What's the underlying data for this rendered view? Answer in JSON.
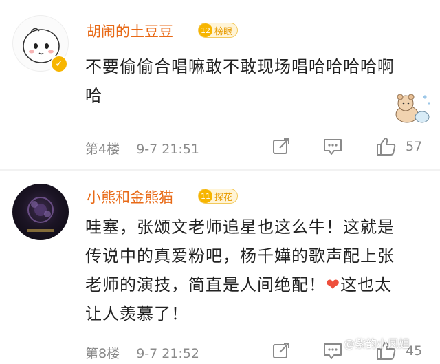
{
  "comments": [
    {
      "username": "胡闹的土豆豆",
      "badge_level": "12",
      "badge_label": "榜眼",
      "text": "不要偷偷合唱嘛敢不敢现场唱哈哈哈哈啊哈",
      "floor": "第4楼",
      "time": "9-7 21:51",
      "likes": "57"
    },
    {
      "username": "小熊和金熊猫",
      "badge_level": "11",
      "badge_label": "探花",
      "text_before_emoji": "哇塞，张颂文老师追星也这么牛！这就是传说中的真爱粉吧，杨千嬅的歌声配上张老师的演技，简直是人间绝配！",
      "emoji": "❤",
      "text_after_emoji": "这也太让人羡慕了！",
      "floor": "第8楼",
      "time": "9-7 21:52",
      "likes": "45"
    }
  ],
  "watermark": "@紫韵小凤姐",
  "colors": {
    "username": "#e86a17",
    "badge": "#f7b500",
    "text": "#222222",
    "meta": "#8a8a8a"
  },
  "icons": [
    "share-icon",
    "reply-icon",
    "like-icon",
    "verified-icon"
  ]
}
